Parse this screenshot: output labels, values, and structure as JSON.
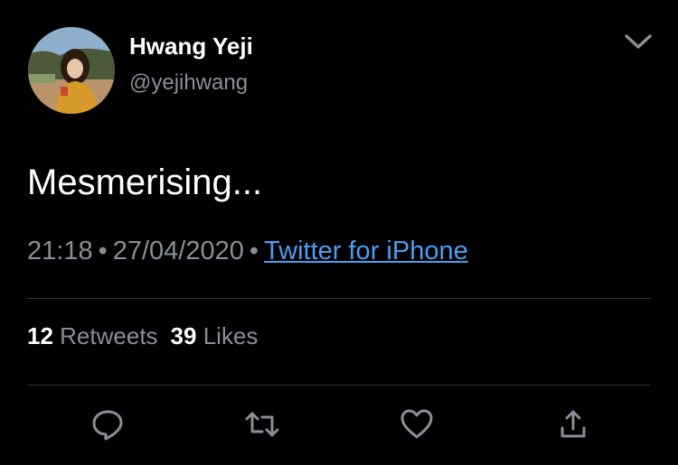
{
  "tweet": {
    "display_name": "Hwang Yeji",
    "handle": "@yejihwang",
    "text": "Mesmerising...",
    "time": "21:18",
    "date": "27/04/2020",
    "separator": "•",
    "source": "Twitter for iPhone"
  },
  "stats": {
    "retweets_count": "12",
    "retweets_label": "Retweets",
    "likes_count": "39",
    "likes_label": "Likes"
  },
  "colors": {
    "background": "#000000",
    "primary_text": "#ffffff",
    "secondary_text": "#8a8f96",
    "link": "#4a9ff0",
    "divider": "#2f3336"
  },
  "icons": {
    "caret": "chevron-down-icon",
    "reply": "reply-icon",
    "retweet": "retweet-icon",
    "like": "heart-icon",
    "share": "share-icon"
  }
}
